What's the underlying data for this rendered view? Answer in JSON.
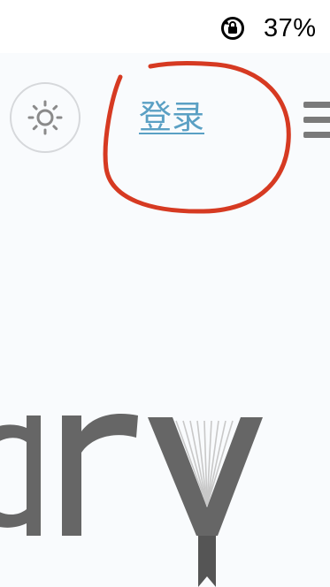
{
  "status_bar": {
    "battery_percent": "37%",
    "icon": "rotation-lock-icon"
  },
  "header": {
    "theme_toggle_icon": "sun-icon",
    "login_label": "登录",
    "menu_icon": "hamburger-menu-icon"
  },
  "annotation": {
    "color": "#d63a22",
    "shape": "hand-drawn-circle"
  },
  "logo": {
    "visible_text": "ary",
    "color": "#666666",
    "icon": "open-book-icon"
  },
  "colors": {
    "link": "#5aa0c4",
    "background": "#f9fbfd",
    "logo": "#666666"
  }
}
